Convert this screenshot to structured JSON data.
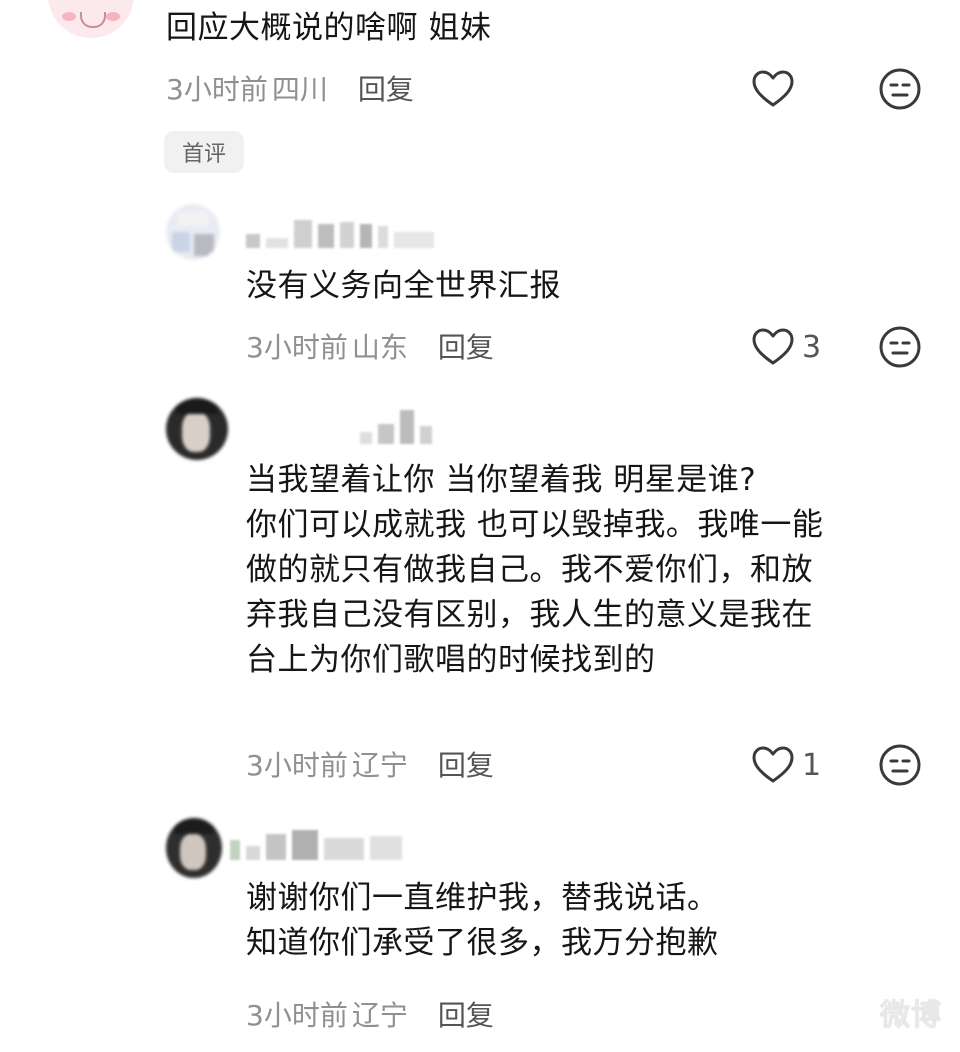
{
  "comments": [
    {
      "text": "回应大概说的啥啊 姐妹",
      "time": "3小时前",
      "location": "四川",
      "reply_label": "回复",
      "likes": "",
      "badge": "首评"
    },
    {
      "text": "没有义务向全世界汇报",
      "time": "3小时前",
      "location": "山东",
      "reply_label": "回复",
      "likes": "3"
    },
    {
      "text": "当我望着让你 当你望着我 明星是谁?\n你们可以成就我 也可以毁掉我。我唯一能\n做的就只有做我自己。我不爱你们，和放\n弃我自己没有区别，我人生的意义是我在\n台上为你们歌唱的时候找到的",
      "time": "3小时前",
      "location": "辽宁",
      "reply_label": "回复",
      "likes": "1"
    },
    {
      "text": "谢谢你们一直维护我，替我说话。\n知道你们承受了很多，我万分抱歉",
      "time": "3小时前",
      "location": "辽宁",
      "reply_label": "回复",
      "likes": ""
    }
  ],
  "icons": {
    "like": "heart-outline-icon",
    "dislike": "neutral-face-icon"
  },
  "colors": {
    "text": "#161616",
    "meta": "#909090",
    "reply": "#555555",
    "icon": "#3a3a3a",
    "badge_bg": "#f1f1f1"
  },
  "watermark": "微博"
}
